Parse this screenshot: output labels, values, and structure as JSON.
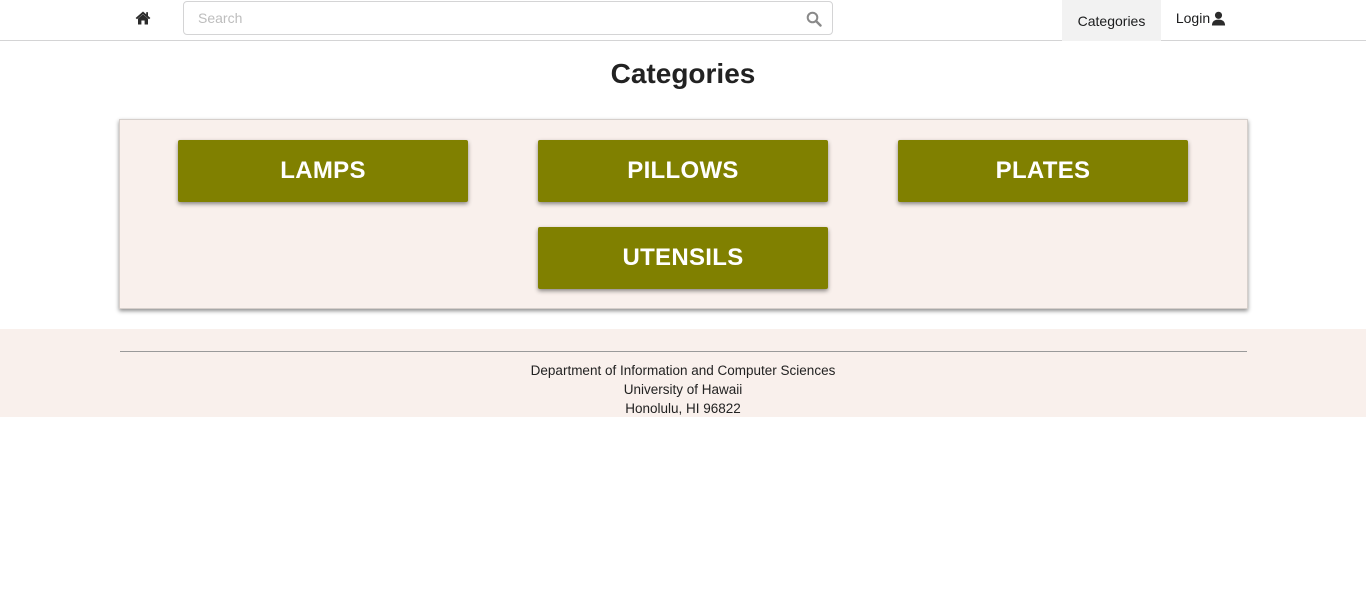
{
  "navbar": {
    "home_icon": "home-icon",
    "search": {
      "placeholder": "Search",
      "value": "",
      "icon": "search-icon"
    },
    "links": [
      {
        "label": "Categories",
        "active": true
      },
      {
        "label": "Login",
        "icon": "user-icon"
      }
    ]
  },
  "main": {
    "title": "Categories",
    "categories": [
      "LAMPS",
      "PILLOWS",
      "PLATES",
      "UTENSILS"
    ]
  },
  "footer": {
    "lines": [
      "Department of Information and Computer Sciences",
      "University of Hawaii",
      "Honolulu, HI 96822"
    ]
  },
  "colors": {
    "category_button": "#808000",
    "panel_background": "#f9f0ec",
    "active_nav_background": "#f2f2f2"
  }
}
